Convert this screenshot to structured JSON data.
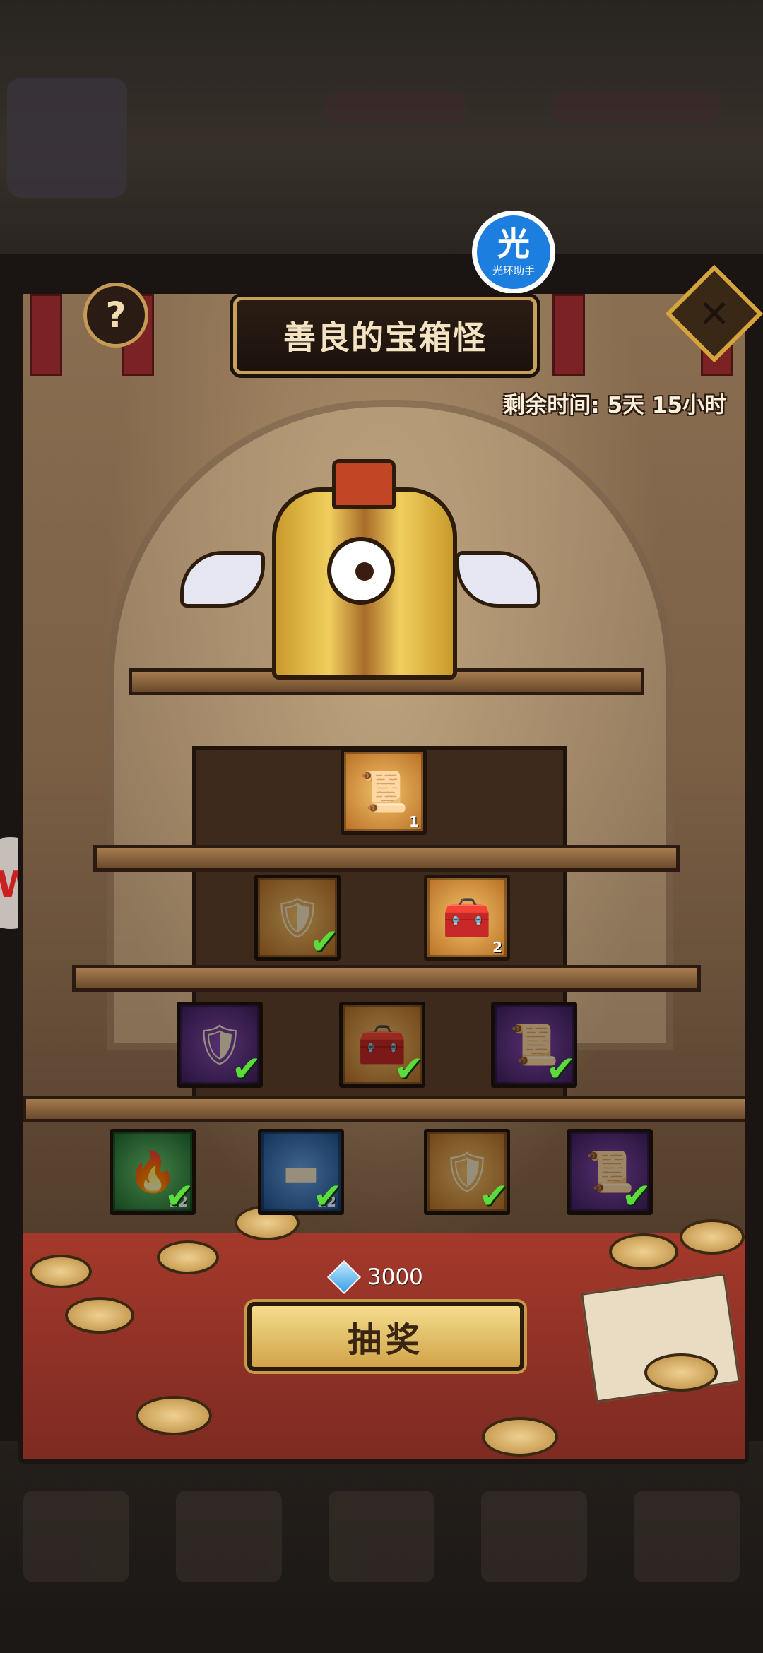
{
  "overlay": {
    "badge_glyph": "光",
    "badge_text": "光环助手"
  },
  "side_badge": {
    "glyph": "W"
  },
  "dialog": {
    "title": "善良的宝箱怪",
    "help_glyph": "?",
    "close_glyph": "✕",
    "timer": "剩余时间:  5天 15小时"
  },
  "rewards": {
    "tier1": [
      {
        "icon": "scroll-icon",
        "glyph": "📜",
        "rarity": "gold",
        "qty": "1",
        "owned": false
      }
    ],
    "tier2": [
      {
        "icon": "shield-icon",
        "glyph": "🛡",
        "rarity": "gold",
        "qty": "",
        "owned": true
      },
      {
        "icon": "chest-icon",
        "glyph": "🧰",
        "rarity": "gold",
        "qty": "2",
        "owned": false
      }
    ],
    "tier3": [
      {
        "icon": "shield-icon",
        "glyph": "🛡",
        "rarity": "purple",
        "qty": "",
        "owned": true
      },
      {
        "icon": "chest-icon",
        "glyph": "🧰",
        "rarity": "gold",
        "qty": "",
        "owned": true
      },
      {
        "icon": "scroll-icon",
        "glyph": "📜",
        "rarity": "purple",
        "qty": "",
        "owned": true
      }
    ],
    "tier4": [
      {
        "icon": "flame-icon",
        "glyph": "🔥",
        "rarity": "green",
        "qty": "12",
        "owned": true
      },
      {
        "icon": "ingot-icon",
        "glyph": "▬",
        "rarity": "blue",
        "qty": "12",
        "owned": true
      },
      {
        "icon": "shield-icon",
        "glyph": "🛡",
        "rarity": "gold",
        "qty": "",
        "owned": true
      },
      {
        "icon": "scroll-icon",
        "glyph": "📜",
        "rarity": "purple",
        "qty": "",
        "owned": true
      }
    ],
    "check_glyph": "✔"
  },
  "draw": {
    "cost": "3000",
    "label": "抽奖"
  },
  "colors": {
    "accent_gold": "#d6a43c",
    "check_green": "#5bdc3a",
    "floor_red": "#a4392b"
  }
}
